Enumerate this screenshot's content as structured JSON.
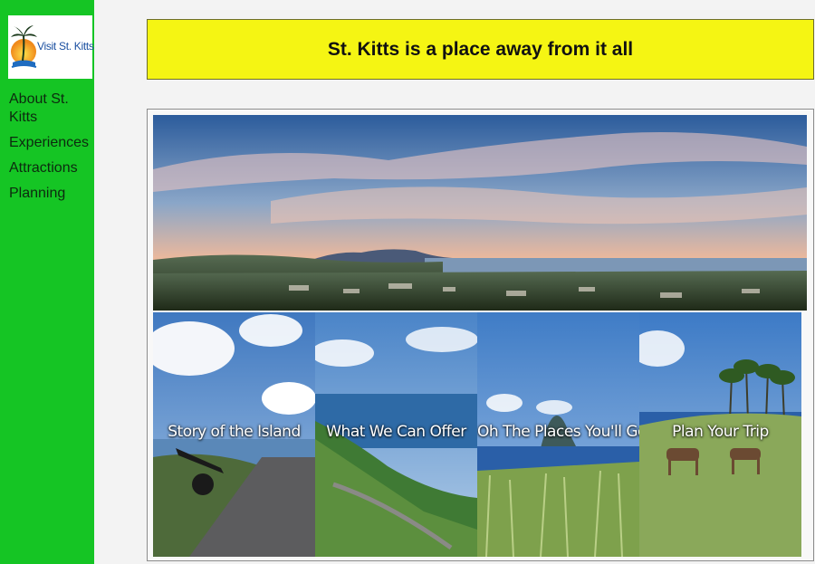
{
  "logo": {
    "text": "Visit St. Kitts",
    "icon": "palm-tree-sunset-logo"
  },
  "nav": {
    "items": [
      {
        "label": "About St. Kitts"
      },
      {
        "label": "Experiences"
      },
      {
        "label": "Attractions"
      },
      {
        "label": "Planning"
      }
    ]
  },
  "banner": {
    "title": "St. Kitts is a place away from it all"
  },
  "hero": {
    "image": "st-kitts-panorama-sunset"
  },
  "tiles": [
    {
      "label": "Story of the Island",
      "image": "fortress-cannon"
    },
    {
      "label": "What We Can Offer",
      "image": "coastal-hillside-road"
    },
    {
      "label": "Oh The Places You'll Go",
      "image": "sugarcane-field-sea"
    },
    {
      "label": "Plan Your Trip",
      "image": "donkeys-palm-field"
    }
  ],
  "colors": {
    "sidebar": "#15c524",
    "banner": "#f5f513",
    "page_background": "#f3f3f3"
  }
}
